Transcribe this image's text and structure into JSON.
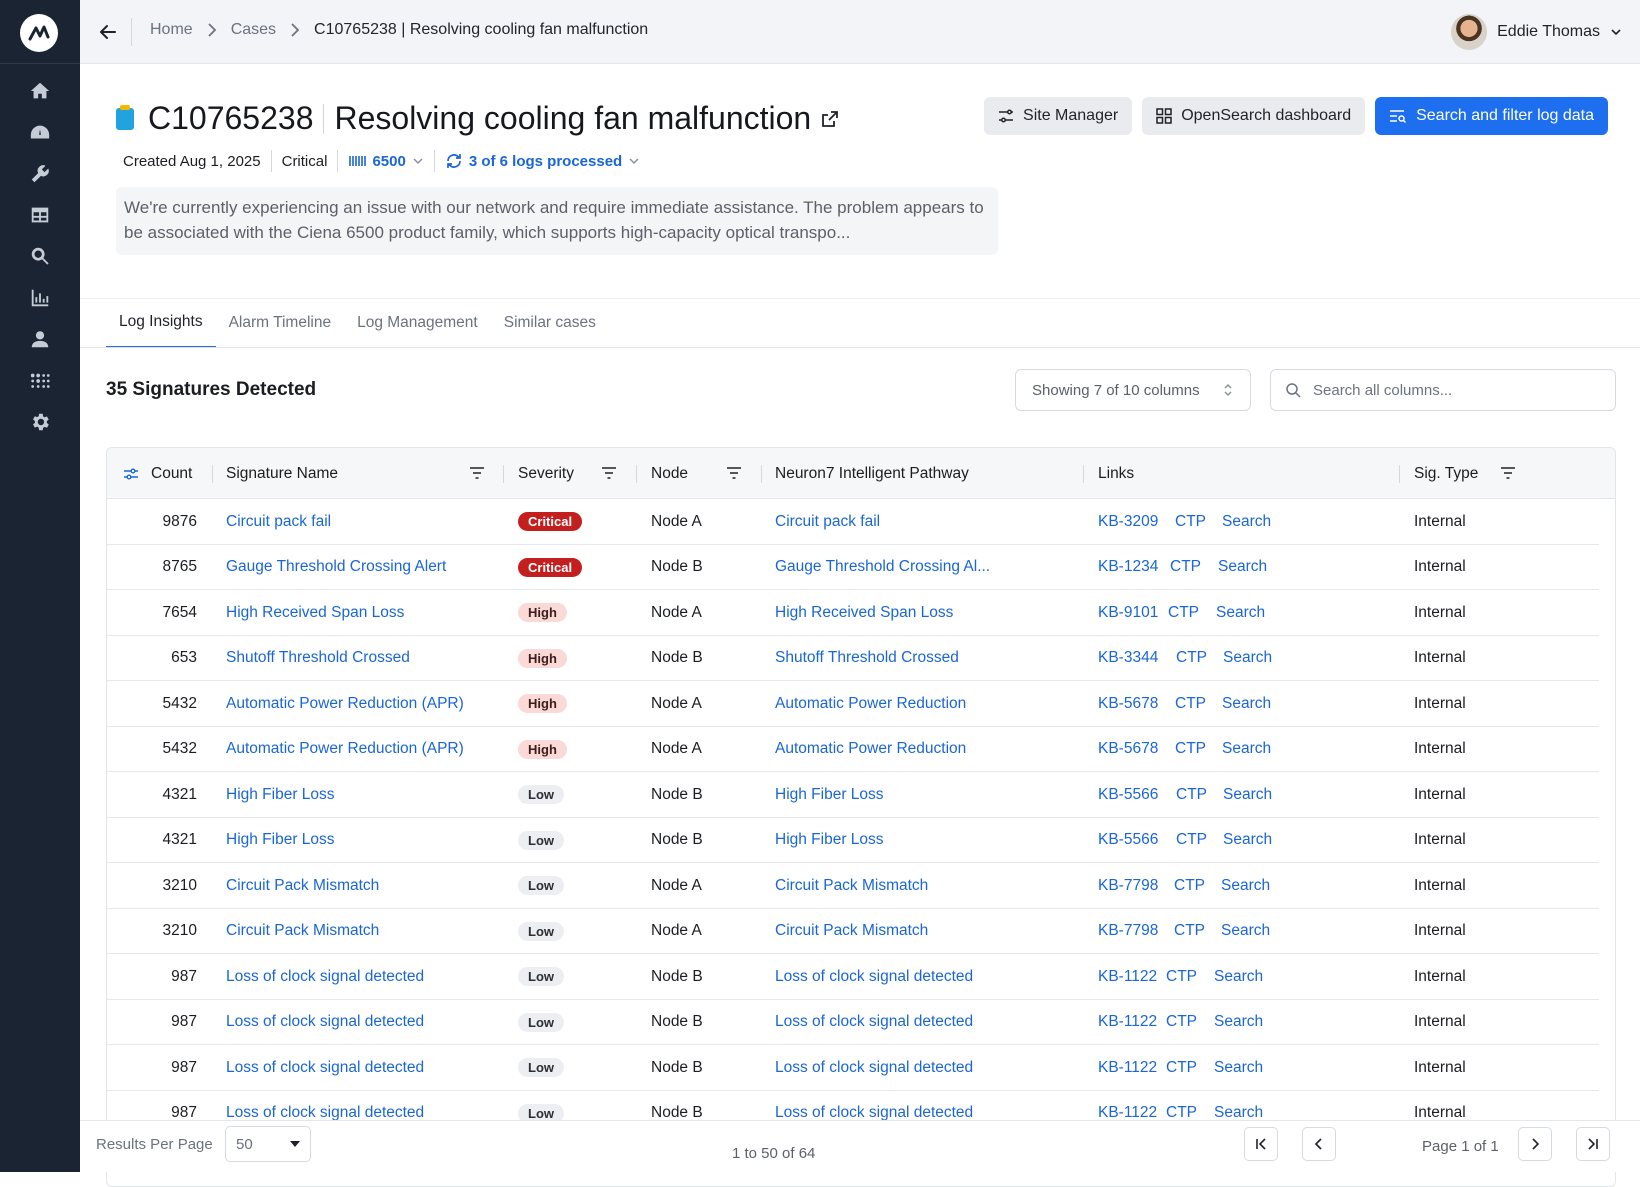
{
  "sidebar": {
    "items": [
      "home-icon",
      "dashboard-icon",
      "wrench-icon",
      "table-icon",
      "search-icon",
      "chart-icon",
      "user-icon",
      "apps-icon",
      "gear-icon"
    ]
  },
  "breadcrumb": {
    "home": "Home",
    "cases": "Cases",
    "current": "C10765238 | Resolving cooling fan malfunction"
  },
  "user": {
    "name": "Eddie Thomas"
  },
  "case": {
    "id": "C10765238",
    "title": "Resolving cooling fan malfunction",
    "created": "Created Aug 1, 2025",
    "priority": "Critical",
    "product": "6500",
    "logs": "3 of 6 logs processed",
    "description": "We're currently experiencing an issue with our network and require immediate assistance. The problem appears to be associated with the Ciena 6500 product family, which supports high-capacity optical transpo..."
  },
  "actions": {
    "site_manager": "Site Manager",
    "opensearch": "OpenSearch dashboard",
    "search_filter": "Search and filter log data"
  },
  "tabs": [
    "Log Insights",
    "Alarm Timeline",
    "Log Management",
    "Similar cases"
  ],
  "signatures": {
    "title": "35 Signatures Detected",
    "columns_selector": "Showing 7 of 10 columns",
    "search_placeholder": "Search all columns..."
  },
  "table": {
    "headers": {
      "count": "Count",
      "signature": "Signature Name",
      "severity": "Severity",
      "node": "Node",
      "pathway": "Neuron7 Intelligent Pathway",
      "links": "Links",
      "sigtype": "Sig. Type"
    },
    "rows": [
      {
        "count": "9876",
        "signature": "Circuit pack fail",
        "severity": "Critical",
        "node": "Node A",
        "pathway": "Circuit pack fail",
        "kb": "KB-3209",
        "ctp": "CTP",
        "search": "Search",
        "type": "Internal"
      },
      {
        "count": "8765",
        "signature": "Gauge Threshold Crossing Alert",
        "severity": "Critical",
        "node": "Node B",
        "pathway": "Gauge Threshold Crossing Al...",
        "kb": "KB-1234",
        "ctp": "CTP",
        "search": "Search",
        "type": "Internal"
      },
      {
        "count": "7654",
        "signature": "High Received Span Loss",
        "severity": "High",
        "node": "Node A",
        "pathway": "High Received Span Loss",
        "kb": "KB-9101",
        "ctp": "CTP",
        "search": "Search",
        "type": "Internal"
      },
      {
        "count": "653",
        "signature": "Shutoff Threshold Crossed",
        "severity": "High",
        "node": "Node B",
        "pathway": "Shutoff Threshold Crossed",
        "kb": "KB-3344",
        "ctp": "CTP",
        "search": "Search",
        "type": "Internal"
      },
      {
        "count": "5432",
        "signature": "Automatic Power Reduction (APR)",
        "severity": "High",
        "node": "Node A",
        "pathway": "Automatic Power Reduction",
        "kb": "KB-5678",
        "ctp": "CTP",
        "search": "Search",
        "type": "Internal"
      },
      {
        "count": "5432",
        "signature": "Automatic Power Reduction (APR)",
        "severity": "High",
        "node": "Node A",
        "pathway": "Automatic Power Reduction",
        "kb": "KB-5678",
        "ctp": "CTP",
        "search": "Search",
        "type": "Internal"
      },
      {
        "count": "4321",
        "signature": "High Fiber Loss",
        "severity": "Low",
        "node": "Node B",
        "pathway": "High Fiber Loss",
        "kb": "KB-5566",
        "ctp": "CTP",
        "search": "Search",
        "type": "Internal"
      },
      {
        "count": "4321",
        "signature": "High Fiber Loss",
        "severity": "Low",
        "node": "Node B",
        "pathway": "High Fiber Loss",
        "kb": "KB-5566",
        "ctp": "CTP",
        "search": "Search",
        "type": "Internal"
      },
      {
        "count": "3210",
        "signature": "Circuit Pack Mismatch",
        "severity": "Low",
        "node": "Node A",
        "pathway": "Circuit Pack Mismatch",
        "kb": "KB-7798",
        "ctp": "CTP",
        "search": "Search",
        "type": "Internal"
      },
      {
        "count": "3210",
        "signature": "Circuit Pack Mismatch",
        "severity": "Low",
        "node": "Node A",
        "pathway": "Circuit Pack Mismatch",
        "kb": "KB-7798",
        "ctp": "CTP",
        "search": "Search",
        "type": "Internal"
      },
      {
        "count": "987",
        "signature": "Loss of clock signal detected",
        "severity": "Low",
        "node": "Node B",
        "pathway": "Loss of clock signal detected",
        "kb": "KB-1122",
        "ctp": "CTP",
        "search": "Search",
        "type": "Internal"
      },
      {
        "count": "987",
        "signature": "Loss of clock signal detected",
        "severity": "Low",
        "node": "Node B",
        "pathway": "Loss of clock signal detected",
        "kb": "KB-1122",
        "ctp": "CTP",
        "search": "Search",
        "type": "Internal"
      },
      {
        "count": "987",
        "signature": "Loss of clock signal detected",
        "severity": "Low",
        "node": "Node B",
        "pathway": "Loss of clock signal detected",
        "kb": "KB-1122",
        "ctp": "CTP",
        "search": "Search",
        "type": "Internal"
      },
      {
        "count": "987",
        "signature": "Loss of clock signal detected",
        "severity": "Low",
        "node": "Node B",
        "pathway": "Loss of clock signal detected",
        "kb": "KB-1122",
        "ctp": "CTP",
        "search": "Search",
        "type": "Internal"
      }
    ]
  },
  "pagination": {
    "rpp_label": "Results Per Page",
    "rpp_value": "50",
    "range": "1 to 50 of 64",
    "page": "Page 1 of 1"
  },
  "colors": {
    "sidebar": "#1b2433",
    "accent": "#1e6ff0",
    "link": "#1a66d6",
    "critical": "#c41f1f",
    "high_bg": "#fbd9d6"
  }
}
